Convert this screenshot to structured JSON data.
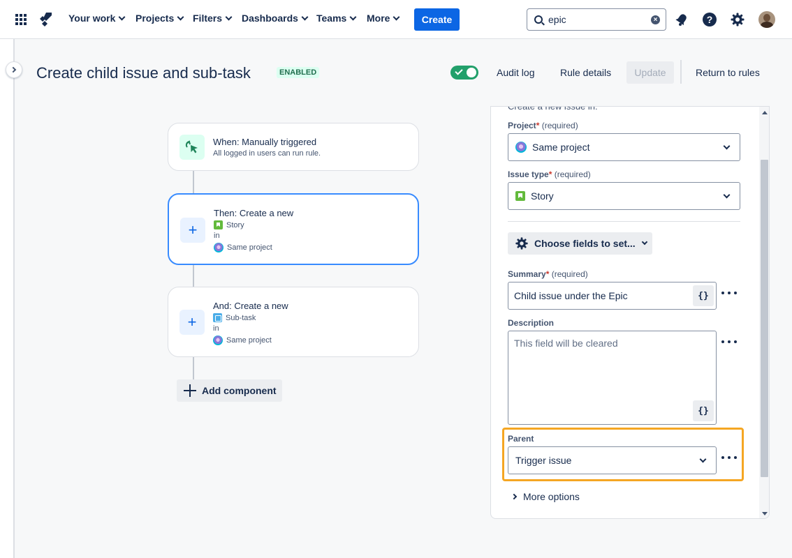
{
  "nav": {
    "items": [
      {
        "label": "Your work"
      },
      {
        "label": "Projects"
      },
      {
        "label": "Filters"
      },
      {
        "label": "Dashboards"
      },
      {
        "label": "Teams"
      },
      {
        "label": "More"
      }
    ],
    "create_label": "Create",
    "search_value": "epic",
    "icons": [
      "app-switcher-icon",
      "jira-logo-icon",
      "search-icon",
      "clear-icon",
      "notification-bell-icon",
      "help-icon",
      "settings-gear-icon",
      "avatar"
    ]
  },
  "header": {
    "title": "Create child issue and sub-task",
    "badge": "ENABLED",
    "audit_log": "Audit log",
    "rule_details": "Rule details",
    "update": "Update",
    "return_to_rules": "Return to rules"
  },
  "rule": {
    "trigger": {
      "title": "When: Manually triggered",
      "subtitle": "All logged in users can run rule."
    },
    "actions": [
      {
        "title": "Then: Create a new",
        "issue_type": "Story",
        "in_label": "in",
        "project": "Same project"
      },
      {
        "title": "And: Create a new",
        "issue_type": "Sub-task",
        "in_label": "in",
        "project": "Same project"
      }
    ],
    "add_component": "Add component"
  },
  "panel": {
    "cut_heading": "Create a new issue in:",
    "project": {
      "label": "Project",
      "hint": "(required)",
      "value": "Same project"
    },
    "issue_type": {
      "label": "Issue type",
      "hint": "(required)",
      "value": "Story"
    },
    "choose_fields": "Choose fields to set...",
    "summary": {
      "label": "Summary",
      "hint": "(required)",
      "value": "Child issue under the Epic",
      "smart_value": "{}"
    },
    "description": {
      "label": "Description",
      "placeholder": "This field will be cleared",
      "smart_value": "{}"
    },
    "parent": {
      "label": "Parent",
      "value": "Trigger issue"
    },
    "more_options": "More options"
  },
  "colors": {
    "brand_blue": "#0c66e4",
    "enabled_green": "#22a06b",
    "highlight": "#f5a623",
    "selected_border": "#388bff"
  }
}
